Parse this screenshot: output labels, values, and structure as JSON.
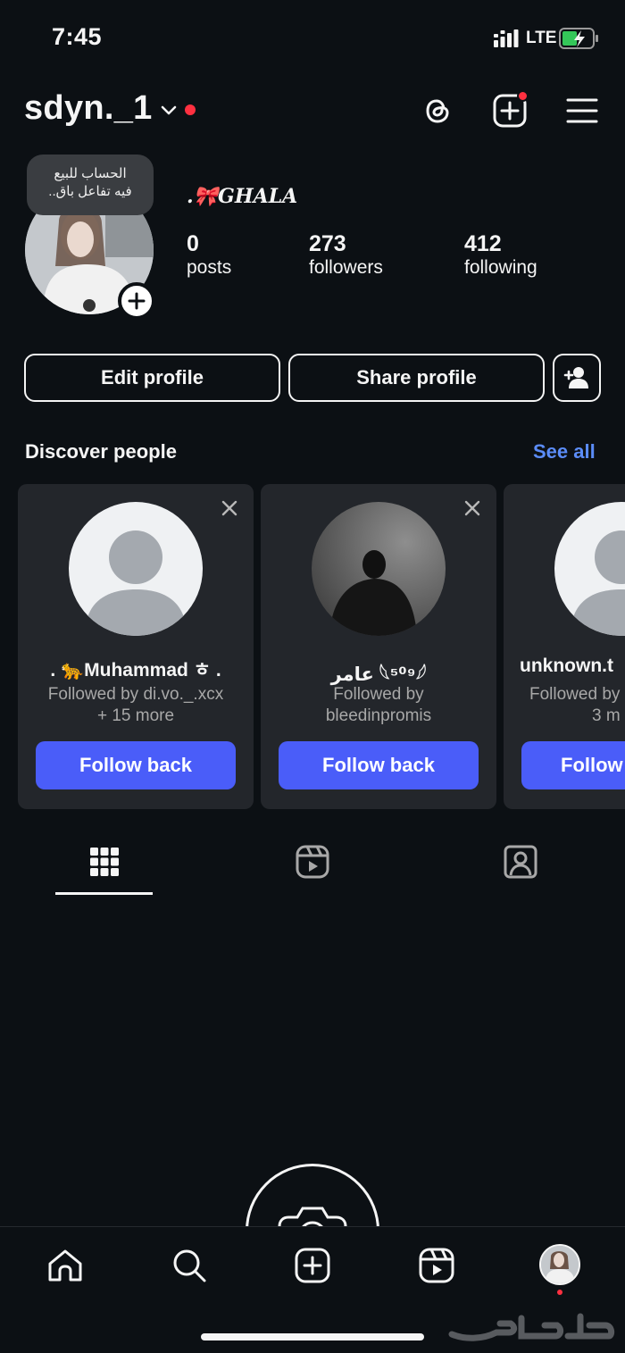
{
  "status_bar": {
    "time": "7:45",
    "network": "LTE"
  },
  "header": {
    "username": "sdyn._1"
  },
  "profile": {
    "note_lines": [
      "الحساب للبيع",
      "فيه تفاعل باق.."
    ],
    "display_name": ".🎀GHALA",
    "stats": [
      {
        "value": "0",
        "label": "posts"
      },
      {
        "value": "273",
        "label": "followers"
      },
      {
        "value": "412",
        "label": "following"
      }
    ]
  },
  "actions": {
    "edit_label": "Edit profile",
    "share_label": "Share profile"
  },
  "discover": {
    "title": "Discover people",
    "see_all": "See all",
    "cards": [
      {
        "name": ". 🐆Muhammad ㅎ .",
        "sub_line1": "Followed by di.vo._.xcx",
        "sub_line2": "+ 15 more",
        "button": "Follow back"
      },
      {
        "name": "عامر 𓆩⁵⁰⁹𓆪",
        "sub_line1": "Followed by",
        "sub_line2": "bleedinpromis",
        "button": "Follow back"
      },
      {
        "name": "unknown.t",
        "sub_line1": "Followed by",
        "sub_line2": "3 m",
        "button": "Follow"
      }
    ]
  },
  "tabs": [
    "grid-icon",
    "reels-icon",
    "tagged-icon"
  ],
  "bottom_nav": [
    "home-icon",
    "search-icon",
    "create-icon",
    "reels-icon",
    "profile-avatar"
  ],
  "colors": {
    "background": "#0c1014",
    "accent_blue": "#4a5df9",
    "link_blue": "#5b8cf7",
    "notification_red": "#ff3040"
  }
}
